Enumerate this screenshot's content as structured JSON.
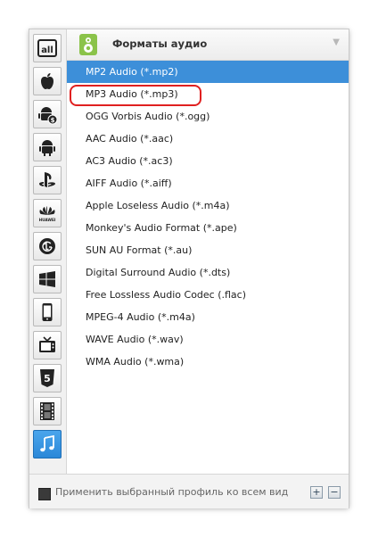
{
  "header": {
    "title": "Форматы аудио",
    "icon": "speaker-icon",
    "collapse_icon": "chevron-down-icon"
  },
  "sidebar": {
    "items": [
      {
        "icon": "all-formats-icon",
        "label": "all",
        "active": false
      },
      {
        "icon": "apple-icon",
        "active": false
      },
      {
        "icon": "android-icon",
        "active": false
      },
      {
        "icon": "android-icon",
        "active": false
      },
      {
        "icon": "playstation-icon",
        "active": false
      },
      {
        "icon": "huawei-icon",
        "label": "HUAWEI",
        "active": false
      },
      {
        "icon": "lg-icon",
        "active": false
      },
      {
        "icon": "windows-icon",
        "active": false
      },
      {
        "icon": "phone-icon",
        "active": false
      },
      {
        "icon": "tv-icon",
        "active": false
      },
      {
        "icon": "html5-icon",
        "label": "5",
        "active": false
      },
      {
        "icon": "film-icon",
        "active": false
      },
      {
        "icon": "music-note-icon",
        "active": true
      }
    ]
  },
  "formats": [
    {
      "label": "MP2 Audio (*.mp2)",
      "selected": true
    },
    {
      "label": "MP3 Audio (*.mp3)",
      "selected": false,
      "highlighted": true
    },
    {
      "label": "OGG Vorbis Audio (*.ogg)",
      "selected": false
    },
    {
      "label": "AAC Audio (*.aac)",
      "selected": false
    },
    {
      "label": "AC3 Audio (*.ac3)",
      "selected": false
    },
    {
      "label": "AIFF Audio (*.aiff)",
      "selected": false
    },
    {
      "label": "Apple Loseless Audio (*.m4a)",
      "selected": false
    },
    {
      "label": "Monkey's Audio Format (*.ape)",
      "selected": false
    },
    {
      "label": "SUN AU Format (*.au)",
      "selected": false
    },
    {
      "label": "Digital Surround Audio (*.dts)",
      "selected": false
    },
    {
      "label": "Free Lossless Audio Codec (.flac)",
      "selected": false
    },
    {
      "label": "MPEG-4 Audio (*.m4a)",
      "selected": false
    },
    {
      "label": "WAVE Audio (*.wav)",
      "selected": false
    },
    {
      "label": "WMA Audio (*.wma)",
      "selected": false
    }
  ],
  "footer": {
    "apply_label": "Применить выбранный профиль ко всем видео",
    "checkbox_checked": true,
    "add_icon": "plus-icon",
    "remove_icon": "minus-icon",
    "add_symbol": "+",
    "remove_symbol": "−"
  },
  "colors": {
    "selection": "#3d8fd9",
    "highlight_ring": "#e02020",
    "active_sidebar": "#2b88d8"
  }
}
